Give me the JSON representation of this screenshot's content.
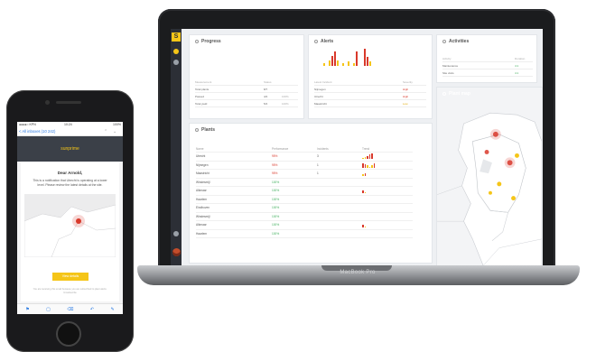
{
  "laptop": {
    "brand_label": "MacBook Pro",
    "logo_letter": "S",
    "panels": {
      "progress": {
        "title": "Progress",
        "columns": [
          "Measurement",
          "Status",
          ""
        ],
        "rows": [
          {
            "name": "Total plants",
            "value": "8/7",
            "extra": ""
          },
          {
            "name": "Passed",
            "value": "4/4",
            "extra": "100%"
          },
          {
            "name": "Total yield",
            "value": "5/4",
            "extra": "100%"
          }
        ]
      },
      "alerts": {
        "title": "Alerts",
        "columns": [
          "Latest Incident",
          "",
          "Severity"
        ],
        "rows": [
          {
            "name": "Nijmegen",
            "severity": "High"
          },
          {
            "name": "Utrecht",
            "severity": "High"
          },
          {
            "name": "Maastricht",
            "severity": "Low"
          }
        ],
        "bars": [
          {
            "h": 2,
            "c": "#f5c518"
          },
          {
            "h": 0,
            "c": "#f5c518"
          },
          {
            "h": 4,
            "c": "#f5c518"
          },
          {
            "h": 7,
            "c": "#d9392b"
          },
          {
            "h": 10,
            "c": "#d9392b"
          },
          {
            "h": 4,
            "c": "#f5c518"
          },
          {
            "h": 0,
            "c": "#f5c518"
          },
          {
            "h": 2,
            "c": "#f5c518"
          },
          {
            "h": 0,
            "c": "#f5c518"
          },
          {
            "h": 3,
            "c": "#f5c518"
          },
          {
            "h": 0,
            "c": "#f5c518"
          },
          {
            "h": 2,
            "c": "#f5c518"
          },
          {
            "h": 10,
            "c": "#d9392b"
          },
          {
            "h": 0,
            "c": "#f5c518"
          },
          {
            "h": 0,
            "c": "#f5c518"
          },
          {
            "h": 12,
            "c": "#d9392b"
          },
          {
            "h": 6,
            "c": "#d9392b"
          },
          {
            "h": 3,
            "c": "#f5c518"
          }
        ]
      },
      "activities": {
        "title": "Activities",
        "columns": [
          "Activity",
          "Duration"
        ],
        "rows": [
          {
            "name": "Maintenance",
            "value": "4:1"
          },
          {
            "name": "Site visits",
            "value": "4:1"
          }
        ]
      },
      "plants": {
        "title": "Plants",
        "columns": [
          "Name",
          "Performance",
          "Incidents",
          "Trend"
        ],
        "rows": [
          {
            "name": "Utrecht",
            "pct": "95%",
            "color": "red",
            "num": "3",
            "trend": [
              1,
              2,
              3,
              4,
              5
            ]
          },
          {
            "name": "Nijmegen",
            "pct": "95%",
            "color": "red",
            "num": "1",
            "trend": [
              4,
              3,
              2,
              1,
              2,
              4
            ]
          },
          {
            "name": "Maastricht",
            "pct": "95%",
            "color": "red",
            "num": "1",
            "trend": [
              2,
              3
            ]
          },
          {
            "name": "Windesmijl",
            "pct": "100%",
            "color": "grn",
            "num": "",
            "trend": []
          },
          {
            "name": "Alkmaar",
            "pct": "100%",
            "color": "grn",
            "num": "",
            "trend": [
              3,
              1
            ]
          },
          {
            "name": "Haarlem",
            "pct": "100%",
            "color": "grn",
            "num": "",
            "trend": []
          },
          {
            "name": "Eindhoven",
            "pct": "100%",
            "color": "grn",
            "num": "",
            "trend": []
          },
          {
            "name": "Windesmijl",
            "pct": "100%",
            "color": "grn",
            "num": "",
            "trend": []
          },
          {
            "name": "Alkmaar",
            "pct": "100%",
            "color": "grn",
            "num": "",
            "trend": [
              3,
              1
            ]
          },
          {
            "name": "Haarlem",
            "pct": "100%",
            "color": "grn",
            "num": "",
            "trend": []
          }
        ]
      },
      "map": {
        "title": "Plant map"
      }
    }
  },
  "phone": {
    "status": {
      "carrier": "●●●●○ KPN",
      "time": "10:24",
      "battery": "100%"
    },
    "back_label": "< All inboxes (10 242)",
    "brand": "sunprime",
    "greeting": "Dear Arnold,",
    "body": "This is a notification that Utrecht is operating at a lower level. Please review the latest details at the site.",
    "cta": "View details",
    "footer": "You are receiving this email because you are subscribed to plant alerts. Unsubscribe"
  },
  "colors": {
    "accent": "#f5c518",
    "alert": "#d9392b",
    "ok": "#3fae5b",
    "dark": "#2c2f36"
  }
}
